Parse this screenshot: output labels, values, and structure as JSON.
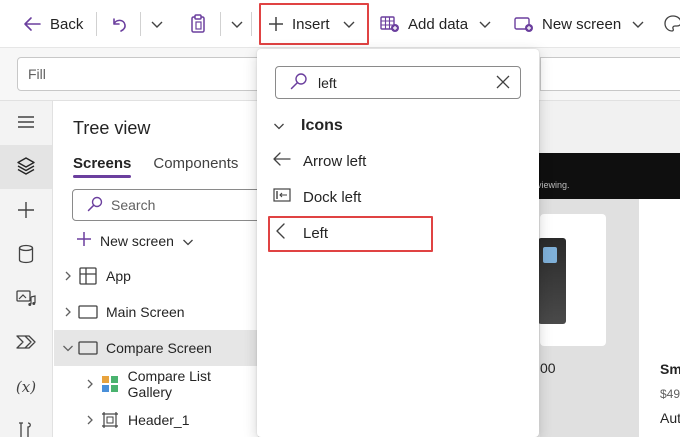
{
  "toolbar": {
    "back_label": "Back",
    "insert_label": "Insert",
    "add_data_label": "Add data",
    "new_screen_label": "New screen"
  },
  "formula_bar": {
    "property_value": "Fill"
  },
  "tree_view": {
    "title": "Tree view",
    "tabs": [
      {
        "label": "Screens",
        "active": true
      },
      {
        "label": "Components",
        "active": false
      }
    ],
    "search_placeholder": "Search",
    "new_screen_label": "New screen",
    "items": [
      {
        "label": "App",
        "expanded": false,
        "icon": "app-icon"
      },
      {
        "label": "Main Screen",
        "expanded": false,
        "icon": "screen-icon"
      },
      {
        "label": "Compare Screen",
        "expanded": true,
        "selected": true,
        "icon": "screen-icon"
      },
      {
        "label": "Compare List Gallery",
        "expanded": false,
        "icon": "gallery-icon"
      },
      {
        "label": "Header_1",
        "expanded": false,
        "icon": "container-icon"
      }
    ]
  },
  "insert_menu": {
    "search_value": "left",
    "category": "Icons",
    "items": [
      {
        "label": "Arrow left",
        "icon": "arrow-left-icon"
      },
      {
        "label": "Dock left",
        "icon": "dock-left-icon"
      },
      {
        "label": "Left",
        "icon": "chevron-left-icon",
        "highlighted": true
      }
    ]
  },
  "canvas": {
    "header_text": "viewing.",
    "card_price_fragment": "00",
    "product_title_fragment": "Sm",
    "product_price_fragment": "$49",
    "product_desc_fragment": "Aut"
  },
  "colors": {
    "highlight_border": "#e04343",
    "accent_purple": "#6b3f9e"
  }
}
